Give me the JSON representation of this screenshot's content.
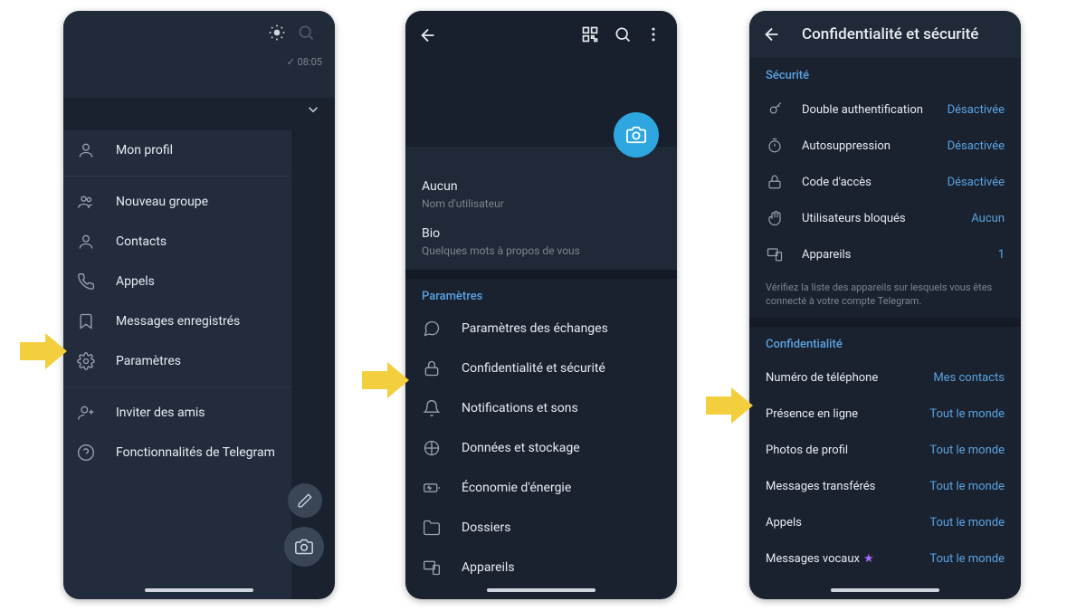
{
  "phone1": {
    "time_hint": "✓ 08:05",
    "menu": [
      {
        "label": "Mon profil",
        "key": "profile"
      },
      "sep",
      {
        "label": "Nouveau groupe",
        "key": "new-group"
      },
      {
        "label": "Contacts",
        "key": "contacts"
      },
      {
        "label": "Appels",
        "key": "calls"
      },
      {
        "label": "Messages enregistrés",
        "key": "saved"
      },
      {
        "label": "Paramètres",
        "key": "settings"
      },
      "sep",
      {
        "label": "Inviter des amis",
        "key": "invite"
      },
      {
        "label": "Fonctionnalités de Telegram",
        "key": "features"
      }
    ]
  },
  "phone2": {
    "username_label": "Aucun",
    "username_sub": "Nom d'utilisateur",
    "bio_label": "Bio",
    "bio_sub": "Quelques mots à propos de vous",
    "section": "Paramètres",
    "items": [
      {
        "label": "Paramètres des échanges",
        "key": "chat-settings"
      },
      {
        "label": "Confidentialité et sécurité",
        "key": "privacy"
      },
      {
        "label": "Notifications et sons",
        "key": "notifications"
      },
      {
        "label": "Données et stockage",
        "key": "data"
      },
      {
        "label": "Économie d'énergie",
        "key": "battery"
      },
      {
        "label": "Dossiers",
        "key": "folders"
      },
      {
        "label": "Appareils",
        "key": "devices"
      }
    ]
  },
  "phone3": {
    "title": "Confidentialité et sécurité",
    "security_label": "Sécurité",
    "security": [
      {
        "label": "Double authentification",
        "val": "Désactivée",
        "key": "2fa"
      },
      {
        "label": "Autosuppression",
        "val": "Désactivée",
        "key": "autodelete"
      },
      {
        "label": "Code d'accès",
        "val": "Désactivée",
        "key": "passcode"
      },
      {
        "label": "Utilisateurs bloqués",
        "val": "Aucun",
        "key": "blocked"
      },
      {
        "label": "Appareils",
        "val": "1",
        "key": "devices"
      }
    ],
    "devices_note": "Vérifiez la liste des appareils sur lesquels vous êtes connecté à votre compte Telegram.",
    "privacy_label": "Confidentialité",
    "privacy": [
      {
        "label": "Numéro de téléphone",
        "val": "Mes contacts",
        "key": "phone-number"
      },
      {
        "label": "Présence en ligne",
        "val": "Tout le monde",
        "key": "last-seen"
      },
      {
        "label": "Photos de profil",
        "val": "Tout le monde",
        "key": "profile-photo"
      },
      {
        "label": "Messages transférés",
        "val": "Tout le monde",
        "key": "forwarded"
      },
      {
        "label": "Appels",
        "val": "Tout le monde",
        "key": "calls"
      },
      {
        "label": "Messages vocaux",
        "val": "Tout le monde",
        "key": "voice",
        "star": true
      }
    ]
  }
}
